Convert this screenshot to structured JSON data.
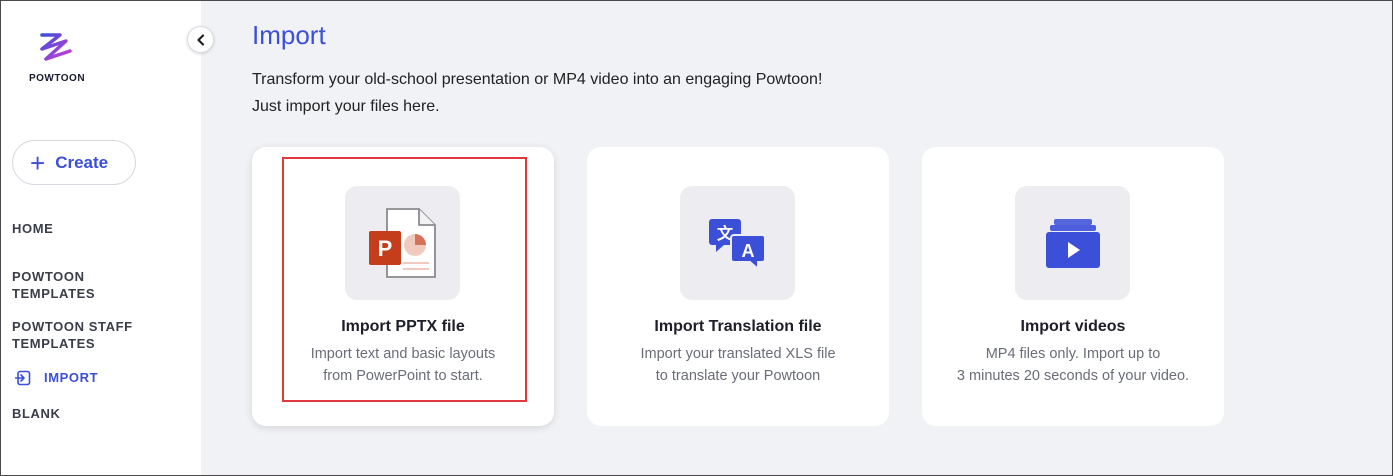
{
  "app": {
    "logo_text": "POWTOON"
  },
  "sidebar": {
    "create_label": "Create",
    "items": [
      {
        "label": "HOME"
      },
      {
        "label": "POWTOON TEMPLATES"
      },
      {
        "label": "POWTOON STAFF TEMPLATES"
      },
      {
        "label": "IMPORT",
        "active": true
      },
      {
        "label": "BLANK"
      }
    ]
  },
  "main": {
    "title": "Import",
    "subtitle_line1": "Transform your old-school presentation or MP4 video into an engaging Powtoon!",
    "subtitle_line2": "Just import your files here.",
    "cards": [
      {
        "title": "Import PPTX file",
        "desc_line1": "Import text and basic layouts",
        "desc_line2": "from PowerPoint to start.",
        "icon": "powerpoint-file-icon"
      },
      {
        "title": "Import Translation file",
        "desc_line1": "Import your translated XLS file",
        "desc_line2": "to translate your Powtoon",
        "icon": "translation-icon"
      },
      {
        "title": "Import videos",
        "desc_line1": "MP4 files only. Import up to",
        "desc_line2": "3 minutes 20 seconds of your video.",
        "icon": "video-stack-icon"
      }
    ]
  },
  "colors": {
    "accent": "#3b4fd8",
    "highlight": "#e0393e",
    "powerpoint": "#c43e1c"
  }
}
